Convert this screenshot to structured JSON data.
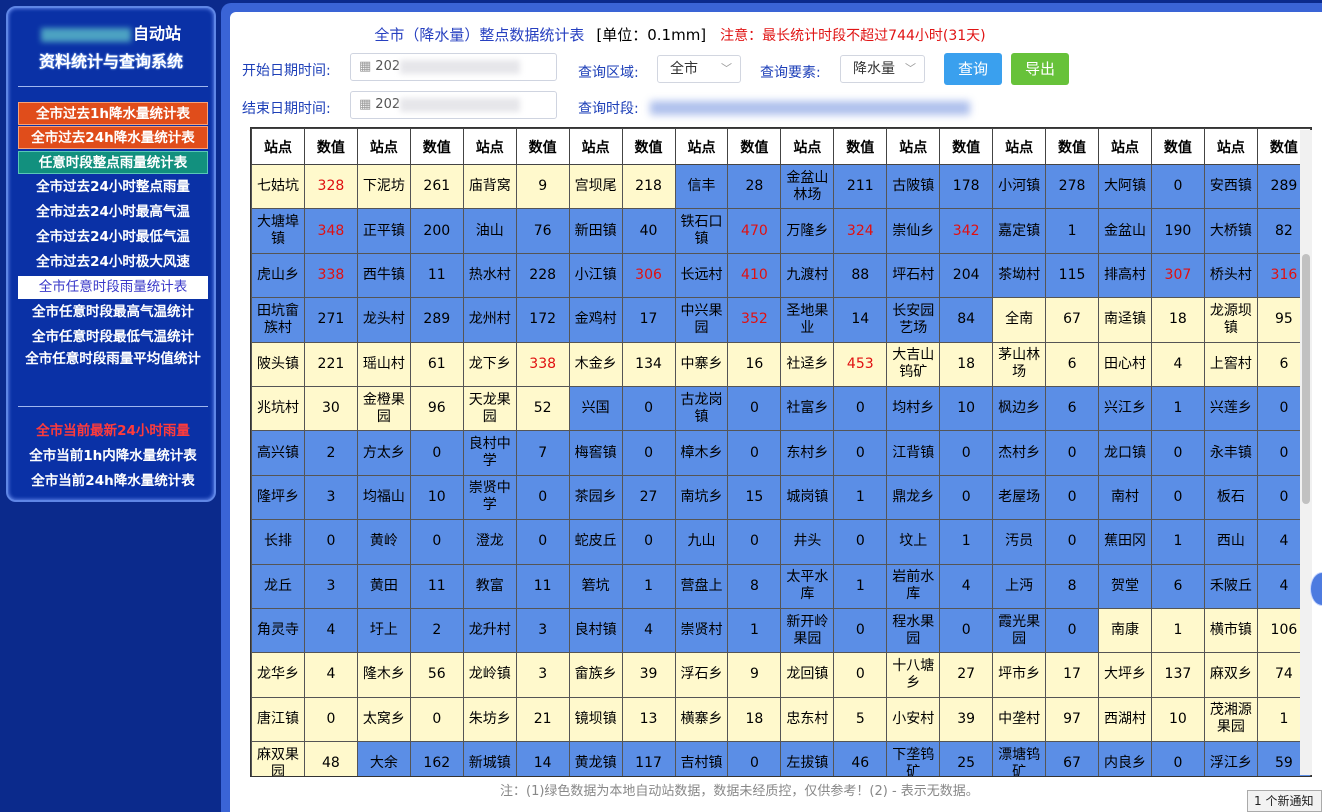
{
  "sidebar": {
    "title_suffix": "自动站",
    "title2": "资料统计与查询系统",
    "menu": [
      "全市过去1h降水量统计表",
      "全市过去24h降水量统计表",
      "任意时段整点雨量统计表",
      "全市过去24小时整点雨量",
      "全市过去24小时最高气温",
      "全市过去24小时最低气温",
      "全市过去24小时极大风速",
      "全市任意时段雨量统计表",
      "全市任意时段最高气温统计",
      "全市任意时段最低气温统计",
      "全市任意时段雨量平均值统计"
    ],
    "menu2": [
      "全市当前最新24小时雨量",
      "全市当前1h内降水量统计表",
      "全市当前24h降水量统计表"
    ]
  },
  "header": {
    "title": "全市（降水量）整点数据统计表",
    "unit": "[单位：0.1mm]",
    "note": "注意：最长统计时段不超过744小时(31天)"
  },
  "form": {
    "start_label": "开始日期时间:",
    "end_label": "结束日期时间:",
    "start_value": "202",
    "end_value": "202",
    "area_label": "查询区域:",
    "area_value": "全市",
    "element_label": "查询要素:",
    "element_value": "降水量",
    "query_button": "查询",
    "export_button": "导出",
    "period_label": "查询时段:"
  },
  "table": {
    "header_station": "站点",
    "header_value": "数值",
    "rows": [
      [
        [
          "七姑坑",
          "y",
          "328",
          "r"
        ],
        [
          "下泥坊",
          "y",
          "261",
          ""
        ],
        [
          "庙背窝",
          "y",
          "9",
          ""
        ],
        [
          "宫坝尾",
          "y",
          "218",
          ""
        ],
        [
          "信丰",
          "b",
          "28",
          ""
        ],
        [
          "金盆山林场",
          "b",
          "211",
          ""
        ],
        [
          "古陂镇",
          "b",
          "178",
          ""
        ],
        [
          "小河镇",
          "b",
          "278",
          ""
        ],
        [
          "大阿镇",
          "b",
          "0",
          ""
        ],
        [
          "安西镇",
          "b",
          "289",
          ""
        ]
      ],
      [
        [
          "大塘埠镇",
          "b",
          "348",
          "r"
        ],
        [
          "正平镇",
          "b",
          "200",
          ""
        ],
        [
          "油山",
          "b",
          "76",
          ""
        ],
        [
          "新田镇",
          "b",
          "40",
          ""
        ],
        [
          "铁石口镇",
          "b",
          "470",
          "r"
        ],
        [
          "万隆乡",
          "b",
          "324",
          "r"
        ],
        [
          "崇仙乡",
          "b",
          "342",
          "r"
        ],
        [
          "嘉定镇",
          "b",
          "1",
          ""
        ],
        [
          "金盆山",
          "b",
          "190",
          ""
        ],
        [
          "大桥镇",
          "b",
          "82",
          ""
        ]
      ],
      [
        [
          "虎山乡",
          "b",
          "338",
          "r"
        ],
        [
          "西牛镇",
          "b",
          "11",
          ""
        ],
        [
          "热水村",
          "b",
          "228",
          ""
        ],
        [
          "小江镇",
          "b",
          "306",
          "r"
        ],
        [
          "长远村",
          "b",
          "410",
          "r"
        ],
        [
          "九渡村",
          "b",
          "88",
          ""
        ],
        [
          "坪石村",
          "b",
          "204",
          ""
        ],
        [
          "茶坳村",
          "b",
          "115",
          ""
        ],
        [
          "排高村",
          "b",
          "307",
          "r"
        ],
        [
          "桥头村",
          "b",
          "316",
          "r"
        ]
      ],
      [
        [
          "田坑畲族村",
          "b",
          "271",
          ""
        ],
        [
          "龙头村",
          "b",
          "289",
          ""
        ],
        [
          "龙州村",
          "b",
          "172",
          ""
        ],
        [
          "金鸡村",
          "b",
          "17",
          ""
        ],
        [
          "中兴果园",
          "b",
          "352",
          "r"
        ],
        [
          "圣地果业",
          "b",
          "14",
          ""
        ],
        [
          "长安园艺场",
          "b",
          "84",
          ""
        ],
        [
          "全南",
          "y",
          "67",
          ""
        ],
        [
          "南迳镇",
          "y",
          "18",
          ""
        ],
        [
          "龙源坝镇",
          "y",
          "95",
          ""
        ]
      ],
      [
        [
          "陂头镇",
          "y",
          "221",
          ""
        ],
        [
          "瑶山村",
          "y",
          "61",
          ""
        ],
        [
          "龙下乡",
          "y",
          "338",
          "r"
        ],
        [
          "木金乡",
          "y",
          "134",
          ""
        ],
        [
          "中寨乡",
          "y",
          "16",
          ""
        ],
        [
          "社迳乡",
          "y",
          "453",
          "r"
        ],
        [
          "大吉山钨矿",
          "y",
          "18",
          ""
        ],
        [
          "茅山林场",
          "y",
          "6",
          ""
        ],
        [
          "田心村",
          "y",
          "4",
          ""
        ],
        [
          "上窖村",
          "y",
          "6",
          ""
        ]
      ],
      [
        [
          "兆坑村",
          "y",
          "30",
          ""
        ],
        [
          "金橙果园",
          "y",
          "96",
          ""
        ],
        [
          "天龙果园",
          "y",
          "52",
          ""
        ],
        [
          "兴国",
          "b",
          "0",
          ""
        ],
        [
          "古龙岗镇",
          "b",
          "0",
          ""
        ],
        [
          "社富乡",
          "b",
          "0",
          ""
        ],
        [
          "均村乡",
          "b",
          "10",
          ""
        ],
        [
          "枫边乡",
          "b",
          "6",
          ""
        ],
        [
          "兴江乡",
          "b",
          "1",
          ""
        ],
        [
          "兴莲乡",
          "b",
          "0",
          ""
        ]
      ],
      [
        [
          "高兴镇",
          "b",
          "2",
          ""
        ],
        [
          "方太乡",
          "b",
          "0",
          ""
        ],
        [
          "良村中学",
          "b",
          "7",
          ""
        ],
        [
          "梅窖镇",
          "b",
          "0",
          ""
        ],
        [
          "樟木乡",
          "b",
          "0",
          ""
        ],
        [
          "东村乡",
          "b",
          "0",
          ""
        ],
        [
          "江背镇",
          "b",
          "0",
          ""
        ],
        [
          "杰村乡",
          "b",
          "0",
          ""
        ],
        [
          "龙口镇",
          "b",
          "0",
          ""
        ],
        [
          "永丰镇",
          "b",
          "0",
          ""
        ]
      ],
      [
        [
          "隆坪乡",
          "b",
          "3",
          ""
        ],
        [
          "均福山",
          "b",
          "10",
          ""
        ],
        [
          "崇贤中学",
          "b",
          "0",
          ""
        ],
        [
          "茶园乡",
          "b",
          "27",
          ""
        ],
        [
          "南坑乡",
          "b",
          "15",
          ""
        ],
        [
          "城岗镇",
          "b",
          "1",
          ""
        ],
        [
          "鼎龙乡",
          "b",
          "0",
          ""
        ],
        [
          "老屋场",
          "b",
          "0",
          ""
        ],
        [
          "南村",
          "b",
          "0",
          ""
        ],
        [
          "板石",
          "b",
          "0",
          ""
        ]
      ],
      [
        [
          "长排",
          "b",
          "0",
          ""
        ],
        [
          "黄岭",
          "b",
          "0",
          ""
        ],
        [
          "澄龙",
          "b",
          "0",
          ""
        ],
        [
          "蛇皮丘",
          "b",
          "0",
          ""
        ],
        [
          "九山",
          "b",
          "0",
          ""
        ],
        [
          "井头",
          "b",
          "0",
          ""
        ],
        [
          "坟上",
          "b",
          "1",
          ""
        ],
        [
          "汚员",
          "b",
          "0",
          ""
        ],
        [
          "蕉田冈",
          "b",
          "1",
          ""
        ],
        [
          "西山",
          "b",
          "4",
          ""
        ]
      ],
      [
        [
          "龙丘",
          "b",
          "3",
          ""
        ],
        [
          "黄田",
          "b",
          "11",
          ""
        ],
        [
          "教富",
          "b",
          "11",
          ""
        ],
        [
          "箬坑",
          "b",
          "1",
          ""
        ],
        [
          "营盘上",
          "b",
          "8",
          ""
        ],
        [
          "太平水库",
          "b",
          "1",
          ""
        ],
        [
          "岩前水库",
          "b",
          "4",
          ""
        ],
        [
          "上沔",
          "b",
          "8",
          ""
        ],
        [
          "贺堂",
          "b",
          "6",
          ""
        ],
        [
          "禾陂丘",
          "b",
          "4",
          ""
        ]
      ],
      [
        [
          "角灵寺",
          "b",
          "4",
          ""
        ],
        [
          "圩上",
          "b",
          "2",
          ""
        ],
        [
          "龙升村",
          "b",
          "3",
          ""
        ],
        [
          "良村镇",
          "b",
          "4",
          ""
        ],
        [
          "崇贤村",
          "b",
          "1",
          ""
        ],
        [
          "新开岭果园",
          "b",
          "0",
          ""
        ],
        [
          "程水果园",
          "b",
          "0",
          ""
        ],
        [
          "霞光果园",
          "b",
          "0",
          ""
        ],
        [
          "南康",
          "y",
          "1",
          ""
        ],
        [
          "横市镇",
          "y",
          "106",
          ""
        ]
      ],
      [
        [
          "龙华乡",
          "y",
          "4",
          ""
        ],
        [
          "隆木乡",
          "y",
          "56",
          ""
        ],
        [
          "龙岭镇",
          "y",
          "3",
          ""
        ],
        [
          "畲族乡",
          "y",
          "39",
          ""
        ],
        [
          "浮石乡",
          "y",
          "9",
          ""
        ],
        [
          "龙回镇",
          "y",
          "0",
          ""
        ],
        [
          "十八塘乡",
          "y",
          "27",
          ""
        ],
        [
          "坪市乡",
          "y",
          "17",
          ""
        ],
        [
          "大坪乡",
          "y",
          "137",
          ""
        ],
        [
          "麻双乡",
          "y",
          "74",
          ""
        ]
      ],
      [
        [
          "唐江镇",
          "y",
          "0",
          ""
        ],
        [
          "太窝乡",
          "y",
          "0",
          ""
        ],
        [
          "朱坊乡",
          "y",
          "21",
          ""
        ],
        [
          "镜坝镇",
          "y",
          "13",
          ""
        ],
        [
          "横寨乡",
          "y",
          "18",
          ""
        ],
        [
          "忠东村",
          "y",
          "5",
          ""
        ],
        [
          "小安村",
          "y",
          "39",
          ""
        ],
        [
          "中垄村",
          "y",
          "97",
          ""
        ],
        [
          "西湖村",
          "y",
          "10",
          ""
        ],
        [
          "茂湘源果园",
          "y",
          "1",
          ""
        ]
      ],
      [
        [
          "麻双果园",
          "y",
          "48",
          ""
        ],
        [
          "大余",
          "b",
          "162",
          ""
        ],
        [
          "新城镇",
          "b",
          "14",
          ""
        ],
        [
          "黄龙镇",
          "b",
          "117",
          ""
        ],
        [
          "吉村镇",
          "b",
          "0",
          ""
        ],
        [
          "左拔镇",
          "b",
          "46",
          ""
        ],
        [
          "下垄钨矿",
          "b",
          "25",
          ""
        ],
        [
          "漂塘钨矿",
          "b",
          "67",
          ""
        ],
        [
          "内良乡",
          "b",
          "0",
          ""
        ],
        [
          "浮江乡",
          "b",
          "59",
          ""
        ]
      ]
    ]
  },
  "footer_note": "注：(1)绿色数据为本地自动站数据，数据未经质控，仅供参考！(2) - 表示无数据。",
  "toast": "1 个新通知"
}
